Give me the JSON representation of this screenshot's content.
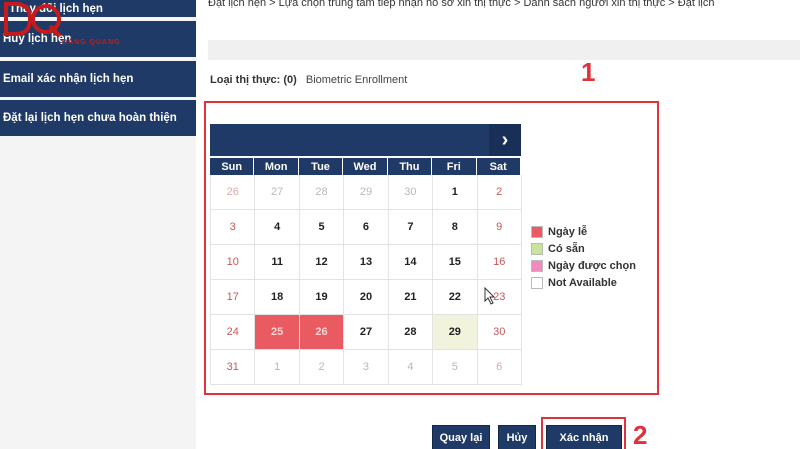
{
  "sidebar": {
    "logo_text": "DQ",
    "logo_sub": "ĐĂNG QUANG",
    "items": [
      {
        "label": "Thay đổi lịch hẹn"
      },
      {
        "label": "Hủy lịch hẹn"
      },
      {
        "label": "Email xác nhận lịch hẹn"
      },
      {
        "label": "Đặt lại lịch hẹn chưa hoàn thiện"
      }
    ]
  },
  "breadcrumb": "Đặt lịch hẹn  >  Lựa chọn trung tâm tiếp nhận hồ sơ xin thị thực  >  Danh sách người xin thị thực  >  Đặt lịch",
  "visa": {
    "label": "Loại thị thực: (0)",
    "value": "Biometric Enrollment"
  },
  "annotations": {
    "one": "1",
    "two": "2"
  },
  "calendar": {
    "next_icon": "›",
    "weekdays": [
      "Sun",
      "Mon",
      "Tue",
      "Wed",
      "Thu",
      "Fri",
      "Sat"
    ],
    "weeks": [
      [
        "26",
        "27",
        "28",
        "29",
        "30",
        "1",
        "2"
      ],
      [
        "3",
        "4",
        "5",
        "6",
        "7",
        "8",
        "9"
      ],
      [
        "10",
        "11",
        "12",
        "13",
        "14",
        "15",
        "16"
      ],
      [
        "17",
        "18",
        "19",
        "20",
        "21",
        "22",
        "23"
      ],
      [
        "24",
        "25",
        "26",
        "27",
        "28",
        "29",
        "30"
      ],
      [
        "31",
        "1",
        "2",
        "3",
        "4",
        "5",
        "6"
      ]
    ],
    "other_month_cells": [
      "0-0",
      "0-1",
      "0-2",
      "0-3",
      "0-4",
      "5-1",
      "5-2",
      "5-3",
      "5-4",
      "5-5",
      "5-6"
    ],
    "holiday_cells": [
      "4-1",
      "4-2"
    ],
    "available_cells": [
      "4-5"
    ]
  },
  "legend": [
    {
      "label": "Ngày lễ",
      "color": "#ea5b61"
    },
    {
      "label": "Có sẵn",
      "color": "#c6e59a"
    },
    {
      "label": "Ngày được chọn",
      "color": "#f08bc0"
    },
    {
      "label": "Not Available",
      "color": "#ffffff"
    }
  ],
  "buttons": {
    "back": "Quay lại",
    "cancel": "Hủy",
    "confirm": "Xác nhận"
  }
}
